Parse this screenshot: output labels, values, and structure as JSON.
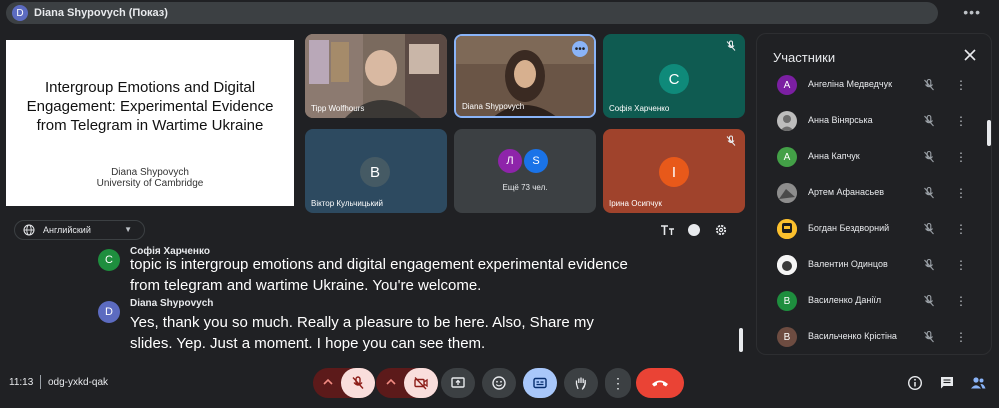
{
  "topbar": {
    "presenter_initial": "D",
    "presenter_label": "Diana Shypovych (Показ)"
  },
  "slide": {
    "title": "Intergroup Emotions and Digital Engagement: Experimental Evidence from Telegram in Wartime Ukraine",
    "author": "Diana Shypovych",
    "affiliation": "University of Cambridge"
  },
  "language": {
    "label": "Английский"
  },
  "tiles": {
    "tipp": {
      "name": "Tipp Wolfhours"
    },
    "diana": {
      "name": "Diana Shypovych"
    },
    "sofia": {
      "name": "Софія Харченко",
      "initial": "C"
    },
    "viktor": {
      "name": "Віктор Кульчицький",
      "initial": "B"
    },
    "more": {
      "label": "Ещё 73 чел.",
      "initial_1": "Л",
      "initial_2": "S"
    },
    "iryna": {
      "name": "Ірина Осипчук",
      "initial": "І"
    }
  },
  "captions": [
    {
      "initial": "C",
      "name": "Софія Харченко",
      "text": "topic is intergroup emotions and digital engagement experimental evidence from telegram and wartime Ukraine. You're welcome.",
      "color": "#1e8e3e"
    },
    {
      "initial": "D",
      "name": "Diana Shypovych",
      "text": "Yes, thank you so much. Really a pleasure to be here. Also, Share my slides. Yep. Just a moment. I hope you can see them.",
      "color": "#5c6bc0"
    }
  ],
  "panel": {
    "title": "Участники",
    "participants": [
      {
        "name": "Ангеліна Медведчук",
        "initial": "А",
        "color": "#7b1fa2"
      },
      {
        "name": "Анна Вінярська",
        "initial": "",
        "color": "#9e9e9e"
      },
      {
        "name": "Анна Капчук",
        "initial": "А",
        "color": "#43a047"
      },
      {
        "name": "Артем Афанасьев",
        "initial": "",
        "color": "#616161"
      },
      {
        "name": "Богдан Бездворний",
        "initial": "",
        "color": "#f9a825"
      },
      {
        "name": "Валентин Одинцов",
        "initial": "",
        "color": "#eeeeee"
      },
      {
        "name": "Василенко Даніїл",
        "initial": "В",
        "color": "#1e8e3e"
      },
      {
        "name": "Васильченко Крістіна",
        "initial": "В",
        "color": "#6d4c41"
      }
    ]
  },
  "bottombar": {
    "time": "11:13",
    "meeting_code": "odg-yxkd-qak"
  },
  "colors": {
    "background": "#202124",
    "accent": "#8ab4f8",
    "end_call": "#ea4335",
    "muted_fill": "#f9dedc"
  }
}
